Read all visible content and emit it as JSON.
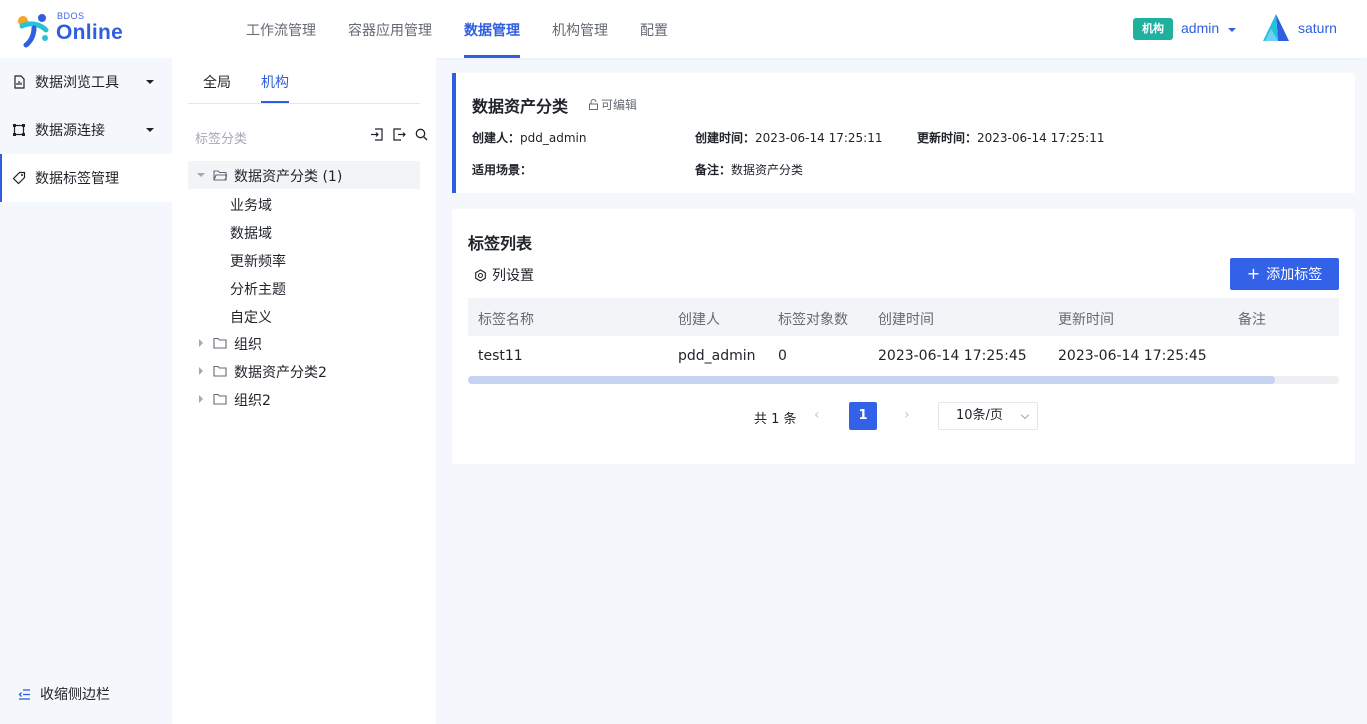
{
  "app": {
    "logo_small": "BDOS",
    "logo_big": "Online"
  },
  "nav": {
    "items": [
      {
        "label": "工作流管理"
      },
      {
        "label": "容器应用管理"
      },
      {
        "label": "数据管理"
      },
      {
        "label": "机构管理"
      },
      {
        "label": "配置"
      }
    ],
    "active_index": 2
  },
  "header_user": {
    "org_badge": "机构",
    "user": "admin",
    "workspace": "saturn"
  },
  "colors": {
    "accent": "#2f5fe0",
    "badge": "#1fb19e",
    "button": "#3361e8"
  },
  "sidebar": {
    "items": [
      {
        "label": "数据浏览工具",
        "icon": "file-chart-icon"
      },
      {
        "label": "数据源连接",
        "icon": "connection-icon"
      },
      {
        "label": "数据标签管理",
        "icon": "tag-icon"
      }
    ],
    "active_index": 2,
    "collapse_label": "收缩侧边栏"
  },
  "tree": {
    "tabs": [
      {
        "label": "全局"
      },
      {
        "label": "机构"
      }
    ],
    "active_tab": 1,
    "section_label": "标签分类",
    "root_expanded": {
      "label": "数据资产分类 (1)",
      "children": [
        "业务域",
        "数据域",
        "更新频率",
        "分析主题",
        "自定义"
      ]
    },
    "collapsed_nodes": [
      {
        "label": "组织"
      },
      {
        "label": "数据资产分类2"
      },
      {
        "label": "组织2"
      }
    ]
  },
  "info": {
    "title": "数据资产分类",
    "editable_label": "可编辑",
    "creator_label": "创建人：",
    "creator": "pdd_admin",
    "created_label": "创建时间：",
    "created": "2023-06-14 17:25:11",
    "updated_label": "更新时间：",
    "updated": "2023-06-14 17:25:11",
    "scene_label": "适用场景：",
    "scene": "",
    "remark_label": "备注：",
    "remark": "数据资产分类"
  },
  "tag_list": {
    "title": "标签列表",
    "column_settings": "列设置",
    "add_button": "添加标签",
    "columns": [
      "标签名称",
      "创建人",
      "标签对象数",
      "创建时间",
      "更新时间",
      "备注"
    ],
    "rows": [
      [
        "test11",
        "pdd_admin",
        "0",
        "2023-06-14 17:25:45",
        "2023-06-14 17:25:45",
        ""
      ]
    ],
    "pagination": {
      "total": "共 1 条",
      "prev": "‹",
      "next": "›",
      "current": "1",
      "page_size": "10条/页"
    }
  }
}
